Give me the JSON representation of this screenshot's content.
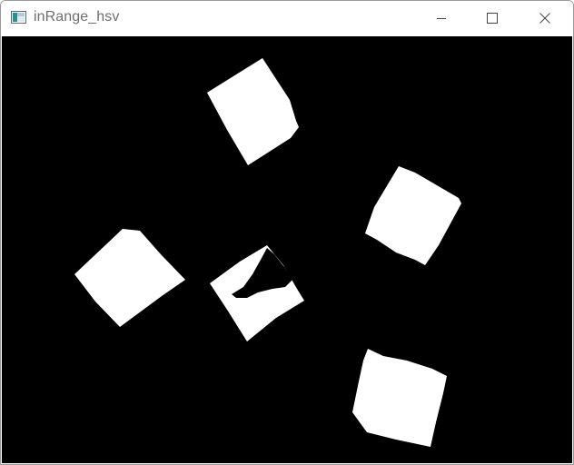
{
  "window": {
    "title": "inRange_hsv",
    "controls": {
      "minimize_icon": "minimize-icon",
      "maximize_icon": "maximize-icon",
      "close_icon": "close-icon"
    }
  },
  "image": {
    "mask_foreground_color": "#ffffff",
    "mask_background_color": "#000000"
  }
}
